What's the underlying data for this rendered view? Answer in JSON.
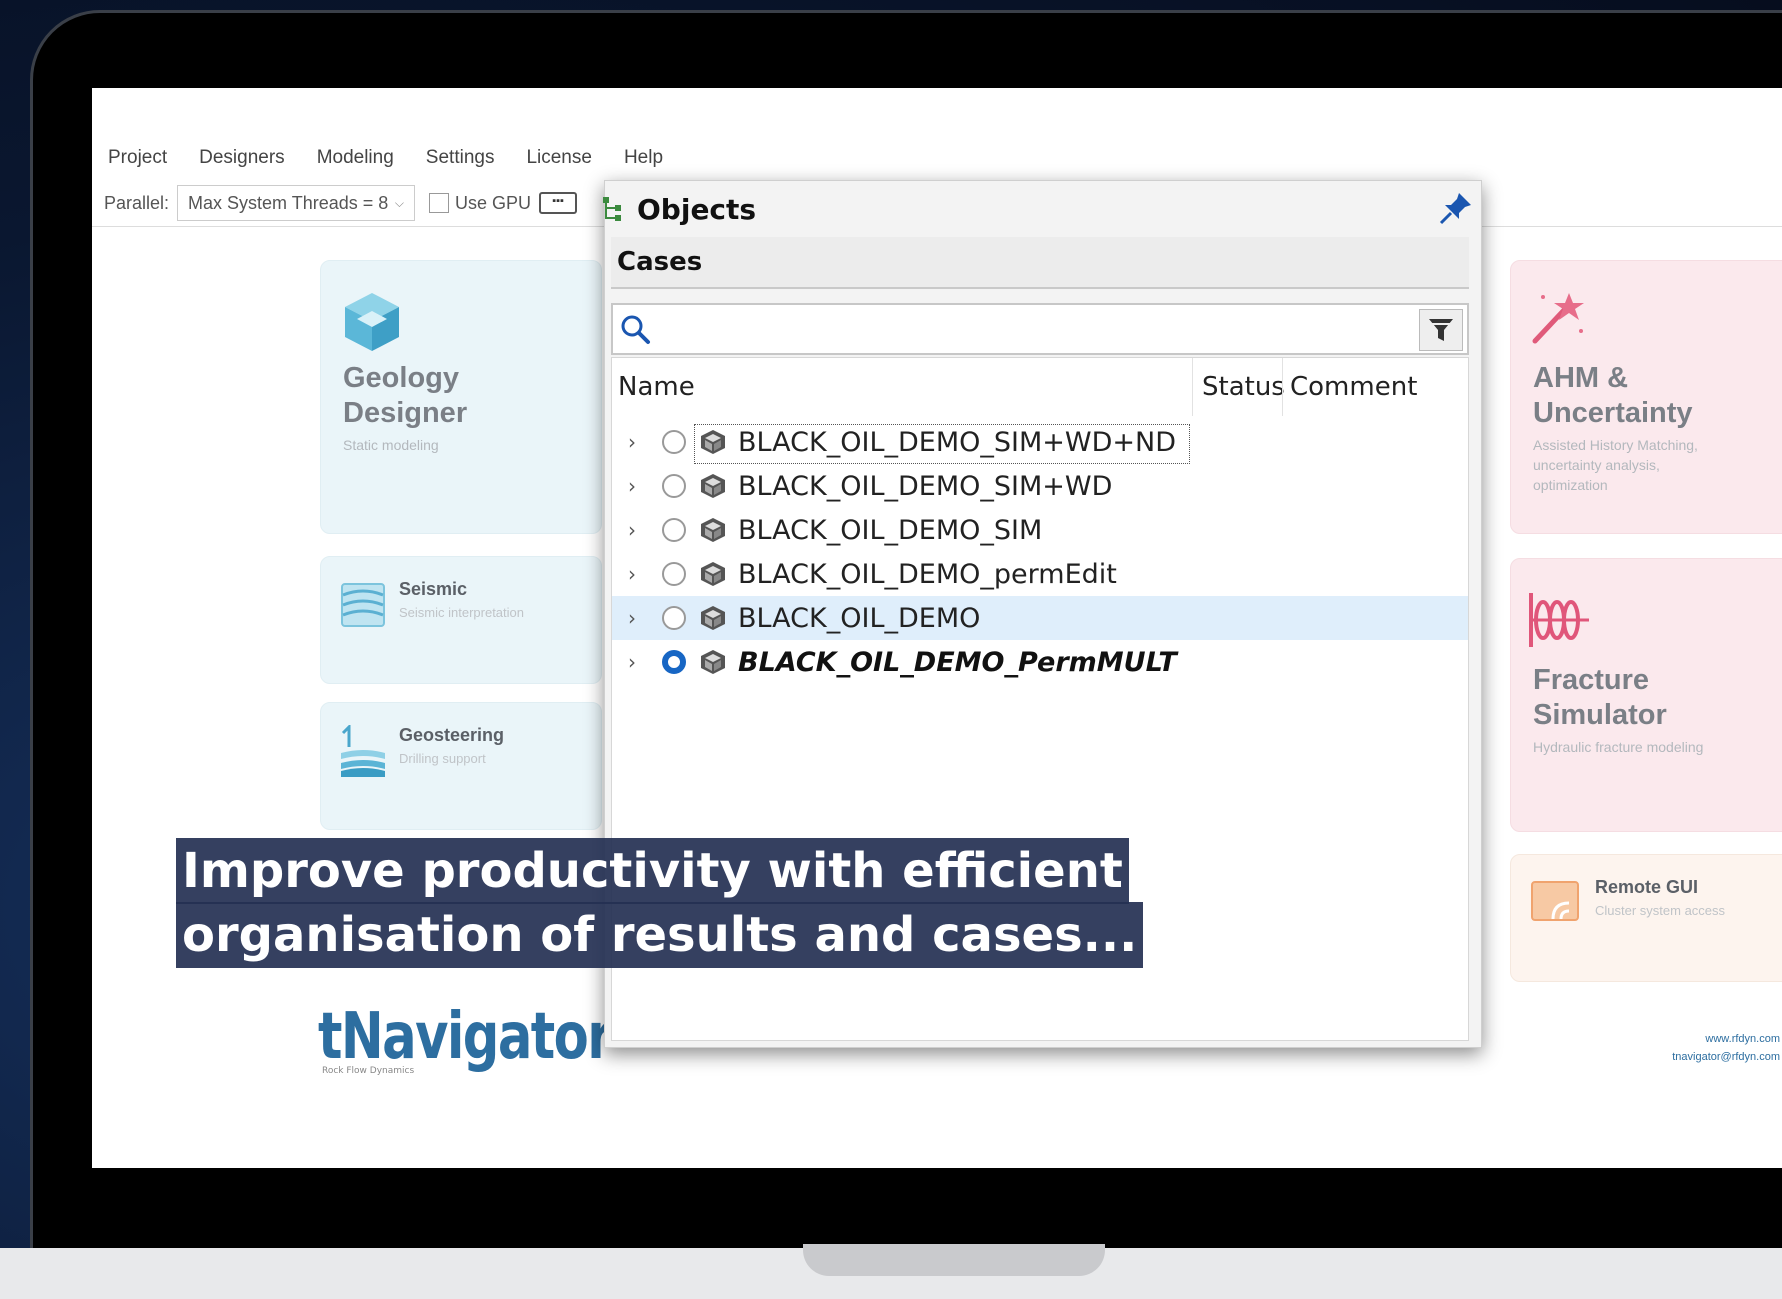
{
  "menu": {
    "items": [
      "Project",
      "Designers",
      "Modeling",
      "Settings",
      "License",
      "Help"
    ]
  },
  "toolbar": {
    "parallel_label": "Parallel:",
    "threads_value": "Max System Threads = 8",
    "use_gpu_label": "Use GPU"
  },
  "cards": {
    "geology": {
      "title": "Geology Designer",
      "subtitle": "Static modeling"
    },
    "seismic": {
      "title": "Seismic",
      "subtitle": "Seismic interpretation"
    },
    "geosteering": {
      "title": "Geosteering",
      "subtitle": "Drilling support"
    },
    "ahm": {
      "title": "AHM & Uncertainty",
      "subtitle": "Assisted History Matching, uncertainty analysis, optimization"
    },
    "fracture": {
      "title": "Fracture Simulator",
      "subtitle": "Hydraulic fracture modeling"
    },
    "remote": {
      "title": "Remote GUI",
      "subtitle": "Cluster system access"
    }
  },
  "logo": {
    "text": "tNavigator",
    "tagline": "Rock Flow Dynamics"
  },
  "contact": {
    "web": "www.rfdyn.com",
    "email": "tnavigator@rfdyn.com"
  },
  "objects_panel": {
    "title": "Objects",
    "section": "Cases",
    "search_placeholder": "",
    "columns": {
      "name": "Name",
      "status": "Status",
      "comment": "Comment"
    },
    "rows": [
      {
        "name": "BLACK_OIL_DEMO_SIM+WD+ND",
        "active": false,
        "selected": false
      },
      {
        "name": "BLACK_OIL_DEMO_SIM+WD",
        "active": false,
        "selected": false
      },
      {
        "name": "BLACK_OIL_DEMO_SIM",
        "active": false,
        "selected": false
      },
      {
        "name": "BLACK_OIL_DEMO_permEdit",
        "active": false,
        "selected": false
      },
      {
        "name": "BLACK_OIL_DEMO",
        "active": false,
        "selected": true
      },
      {
        "name": "BLACK_OIL_DEMO_PermMULT",
        "active": true,
        "selected": false
      }
    ]
  },
  "caption": {
    "line1": "Improve productivity with efficient",
    "line2": "organisation of results and cases..."
  }
}
